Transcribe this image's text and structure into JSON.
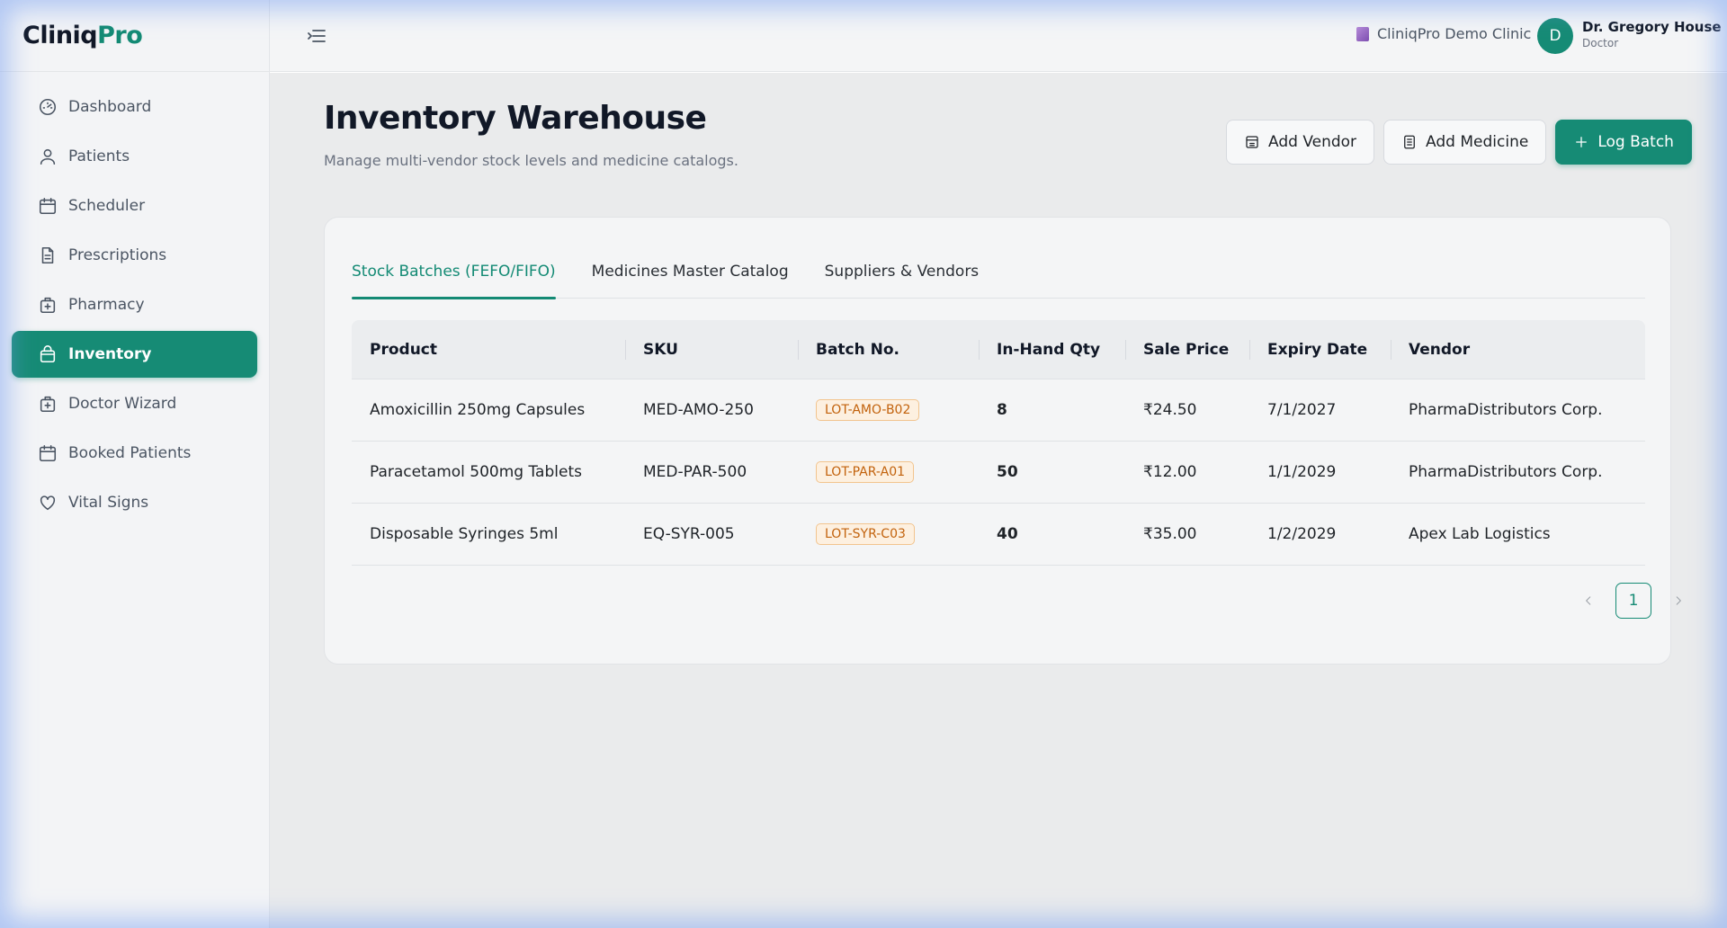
{
  "brand": {
    "part1": "Cliniq",
    "part2": "Pro"
  },
  "sidebar": {
    "items": [
      {
        "label": "Dashboard",
        "icon": "gauge-icon"
      },
      {
        "label": "Patients",
        "icon": "user-icon"
      },
      {
        "label": "Scheduler",
        "icon": "calendar-icon"
      },
      {
        "label": "Prescriptions",
        "icon": "document-icon"
      },
      {
        "label": "Pharmacy",
        "icon": "medkit-icon"
      },
      {
        "label": "Inventory",
        "icon": "package-icon",
        "active": true
      },
      {
        "label": "Doctor Wizard",
        "icon": "medkit-icon"
      },
      {
        "label": "Booked Patients",
        "icon": "calendar-icon"
      },
      {
        "label": "Vital Signs",
        "icon": "heart-icon"
      }
    ]
  },
  "header": {
    "clinic_name": "CliniqPro Demo Clinic",
    "avatar_initial": "D",
    "user_name": "Dr. Gregory House",
    "user_role": "Doctor"
  },
  "page": {
    "title": "Inventory Warehouse",
    "subtitle": "Manage multi-vendor stock levels and medicine catalogs."
  },
  "actions": {
    "add_vendor": "Add Vendor",
    "add_medicine": "Add Medicine",
    "log_batch": "Log Batch"
  },
  "tabs": [
    {
      "label": "Stock Batches (FEFO/FIFO)",
      "active": true
    },
    {
      "label": "Medicines Master Catalog"
    },
    {
      "label": "Suppliers & Vendors"
    }
  ],
  "table": {
    "headers": [
      "Product",
      "SKU",
      "Batch No.",
      "In-Hand Qty",
      "Sale Price",
      "Expiry Date",
      "Vendor"
    ],
    "rows": [
      {
        "product": "Amoxicillin 250mg Capsules",
        "sku": "MED-AMO-250",
        "batch": "LOT-AMO-B02",
        "qty": "8",
        "price": "₹24.50",
        "expiry": "7/1/2027",
        "vendor": "PharmaDistributors Corp."
      },
      {
        "product": "Paracetamol 500mg Tablets",
        "sku": "MED-PAR-500",
        "batch": "LOT-PAR-A01",
        "qty": "50",
        "price": "₹12.00",
        "expiry": "1/1/2029",
        "vendor": "PharmaDistributors Corp."
      },
      {
        "product": "Disposable Syringes 5ml",
        "sku": "EQ-SYR-005",
        "batch": "LOT-SYR-C03",
        "qty": "40",
        "price": "₹35.00",
        "expiry": "1/2/2029",
        "vendor": "Apex Lab Logistics"
      }
    ]
  },
  "pagination": {
    "current": "1"
  },
  "colors": {
    "accent": "#168b75",
    "badge_text": "#c2620c",
    "badge_bg": "#fdf0e0"
  }
}
